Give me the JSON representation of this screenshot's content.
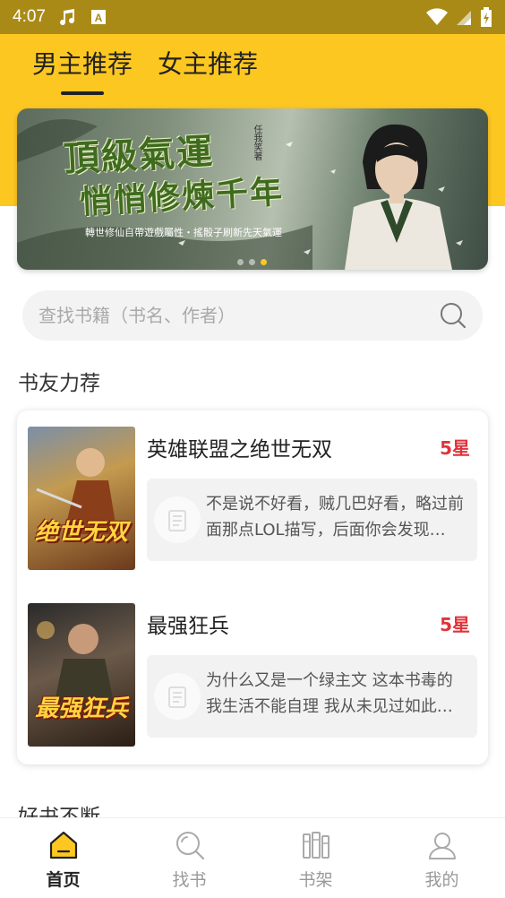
{
  "status_bar": {
    "time": "4:07",
    "left_icons": [
      "music-note-icon",
      "a-badge-icon"
    ],
    "right_icons": [
      "wifi-icon",
      "signal-icon",
      "battery-icon"
    ]
  },
  "tabs": [
    {
      "label": "男主推荐",
      "active": true
    },
    {
      "label": "女主推荐",
      "active": false
    }
  ],
  "banner": {
    "title": "頂級氣運",
    "subtitle": "悄悄修煉千年",
    "caption": "轉世修仙自帶遊戲屬性・搖骰子刷新先天氣運",
    "author": "任我笑著",
    "dots": 3,
    "active_dot": 2
  },
  "search": {
    "placeholder": "查找书籍（书名、作者）"
  },
  "sections": {
    "recommend_title": "书友力荐",
    "more_title": "好书不断"
  },
  "recommendations": [
    {
      "title": "英雄联盟之绝世无双",
      "rating": "5星",
      "cover_text": "绝世无双",
      "review": "不是说不好看，贼几巴好看，略过前面那点LOL描写，后面你会发现…"
    },
    {
      "title": "最强狂兵",
      "rating": "5星",
      "cover_text": "最强狂兵",
      "review": "为什么又是一个绿主文 这本书毒的我生活不能自理  我从未见过如此…"
    }
  ],
  "bottom_nav": [
    {
      "label": "首页",
      "icon": "home-icon",
      "active": true
    },
    {
      "label": "找书",
      "icon": "search-icon",
      "active": false
    },
    {
      "label": "书架",
      "icon": "bookshelf-icon",
      "active": false
    },
    {
      "label": "我的",
      "icon": "profile-icon",
      "active": false
    }
  ],
  "colors": {
    "status_bar": "#a98a16",
    "header": "#fdc722",
    "rating": "#e0333a",
    "active_dot": "#fdc722"
  }
}
